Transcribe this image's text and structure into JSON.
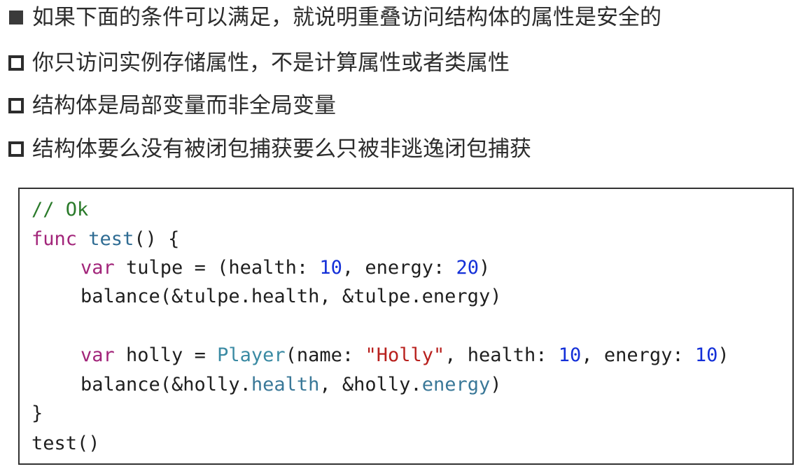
{
  "bullets": [
    {
      "marker": "filled-square",
      "text": "如果下面的条件可以满足，就说明重叠访问结构体的属性是安全的"
    },
    {
      "marker": "hollow-square",
      "text": "你只访问实例存储属性，不是计算属性或者类属性"
    },
    {
      "marker": "hollow-square",
      "text": "结构体是局部变量而非全局变量"
    },
    {
      "marker": "hollow-square",
      "text": "结构体要么没有被闭包捕获要么只被非逃逸闭包捕获"
    }
  ],
  "code": {
    "comment": "// Ok",
    "kw_func": "func",
    "fn_test": "test",
    "fn_parens_open": "() {",
    "kw_var": "var",
    "tulpe_decl": " tulpe = (health: ",
    "num_10": "10",
    "energy_label": ", energy: ",
    "num_20": "20",
    "close_paren": ")",
    "balance_tulpe": "balance(&tulpe.health, &tulpe.energy)",
    "holly_decl": " holly = ",
    "type_player": "Player",
    "name_label": "(name: ",
    "holly_string": "\"Holly\"",
    "health_label": ", health: ",
    "balance_open": "balance(&holly.",
    "prop_health": "health",
    "holly_mid": ", &holly.",
    "prop_energy": "energy",
    "close_brace": "}",
    "call_test": "test()"
  },
  "colors": {
    "comment": "#2a7a2a",
    "keyword": "#a2257a",
    "function": "#2f6c93",
    "number": "#1430d8",
    "string": "#b8201d",
    "type": "#3a8aa3",
    "property": "#3a7898"
  }
}
